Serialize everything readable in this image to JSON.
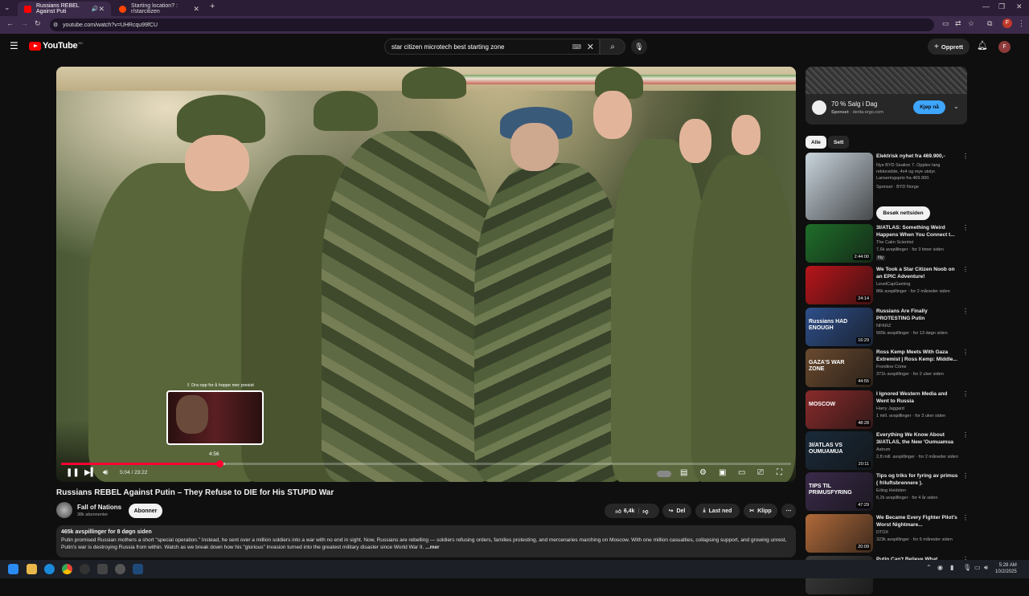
{
  "browser": {
    "tabs": [
      {
        "title": "Russians REBEL Against Puti",
        "active": true
      },
      {
        "title": "Starting location? : r/starcitizen",
        "active": false
      }
    ],
    "url": "youtube.com/watch?v=UHRcqu99fCU"
  },
  "header": {
    "logo": "YouTube",
    "region": "NO",
    "search_query": "star citizen microtech best starting zone",
    "create_label": "Opprett",
    "avatar_letter": "F"
  },
  "player": {
    "drag_hint": "Dra opp for å hoppe mer presist",
    "hover_time": "4:56",
    "current_time": "5:04 / 23:22",
    "progress_fraction": 0.2168,
    "buffered_fraction": 0.2252,
    "hover_fraction": 0.2112
  },
  "video": {
    "title": "Russians REBEL Against Putin – They Refuse to DIE for His STUPID War",
    "channel": "Fall of Nations",
    "subscribers": "38k abonnenter",
    "subscribe_label": "Abonner",
    "likes": "6,4k",
    "share_label": "Del",
    "download_label": "Last ned",
    "clip_label": "Klipp",
    "views_line": "465k avspillinger  for 8 døgn siden",
    "description": "Putin promised Russian mothers a short \"special operation.\" Instead, he sent over a million soldiers into a war with no end in sight. Now, Russians are rebelling — soldiers refusing orders, families protesting, and mercenaries marching on Moscow. With one million casualties, collapsing support, and growing unrest, Putin's war is destroying Russia from within. Watch as we break down how his \"glorious\" invasion turned into the greatest military disaster since World War II.",
    "more_label": "...mer"
  },
  "ad": {
    "title": "70 % Salg i Dag",
    "sponsor_label": "Sponset",
    "domain": "derila-ergo.com",
    "button": "Kjøp nå"
  },
  "chips": [
    "Alle",
    "Sett"
  ],
  "recommendations": [
    {
      "title": "Elektrisk nyhet fra 469.900,-",
      "line1": "Nye BYD Sealion 7. Opplev lang rekkevidde, 4x4 og mye utstyr. Lanseringspris fra 469.900.",
      "line2": "Sponset · BYD Norge",
      "button": "Besøk nettsiden",
      "duration": "",
      "color": "#c9d4dc"
    },
    {
      "title": "3I/ATLAS: Something Weird Happens When You Connect t...",
      "line1": "The Calm Scientist",
      "line2": "7,6k avspillinger · for 3 timer siden",
      "badge": "Ny",
      "duration": "2:44:00",
      "color": "#1f6e2a"
    },
    {
      "title": "We Took a Star Citizen Noob on an EPIC Adventure!",
      "line1": "LevelCapGaming",
      "line2": "86k avspillinger · for 2 måneder siden",
      "duration": "24:14",
      "color": "#b8151a"
    },
    {
      "title": "Russians Are Finally PROTESTING Putin",
      "line1": "NFKRZ",
      "line2": "565k avspillinger · for 13 døgn siden",
      "duration": "16:29",
      "color": "#2e4f8a",
      "thumb_text": "Russians HAD ENOUGH"
    },
    {
      "title": "Ross Kemp Meets With Gaza Extremist | Ross Kemp: Middle...",
      "line1": "Frontline Crime",
      "line2": "371k avspillinger · for 2 uker siden",
      "duration": "44:55",
      "color": "#6a4a2e",
      "thumb_text": "GAZA'S WAR ZONE"
    },
    {
      "title": "I Ignored Western Media and Went to Russia",
      "line1": "Harry Jaggard",
      "line2": "1 mill. avspillinger · for 3 uker siden",
      "duration": "48:28",
      "color": "#8a2b2b",
      "thumb_text": "MOSCOW"
    },
    {
      "title": "Everything We Know About 3I/ATLAS, the New 'Oumuamua",
      "line1": "Astrum",
      "line2": "2,8 mill. avspillinger · for 2 måneder siden",
      "duration": "20:11",
      "color": "#1a2a3a",
      "thumb_text": "3I/ATLAS VS OUMUAMUA"
    },
    {
      "title": "Tips og triks for fyring av primus ( friluftsbrennere ).",
      "line1": "Erling Hvidsten",
      "line2": "6,2k avspillinger · for 4 år siden",
      "duration": "47:29",
      "color": "#3a2a4a",
      "thumb_text": "TIPS TIL PRIMUSFYRING"
    },
    {
      "title": "We Became Every Fighter Pilot's Worst Nightmare...",
      "line1": "DTOX",
      "line2": "323k avspillinger · for 6 måneder siden",
      "duration": "20:09",
      "color": "#b06a3a"
    },
    {
      "title": "Putin Can't Believe What...",
      "line1": "",
      "line2": "",
      "duration": "",
      "color": "#3a3a3a"
    }
  ],
  "taskbar": {
    "time": "5:28 AM",
    "date": "10/2/2025"
  }
}
